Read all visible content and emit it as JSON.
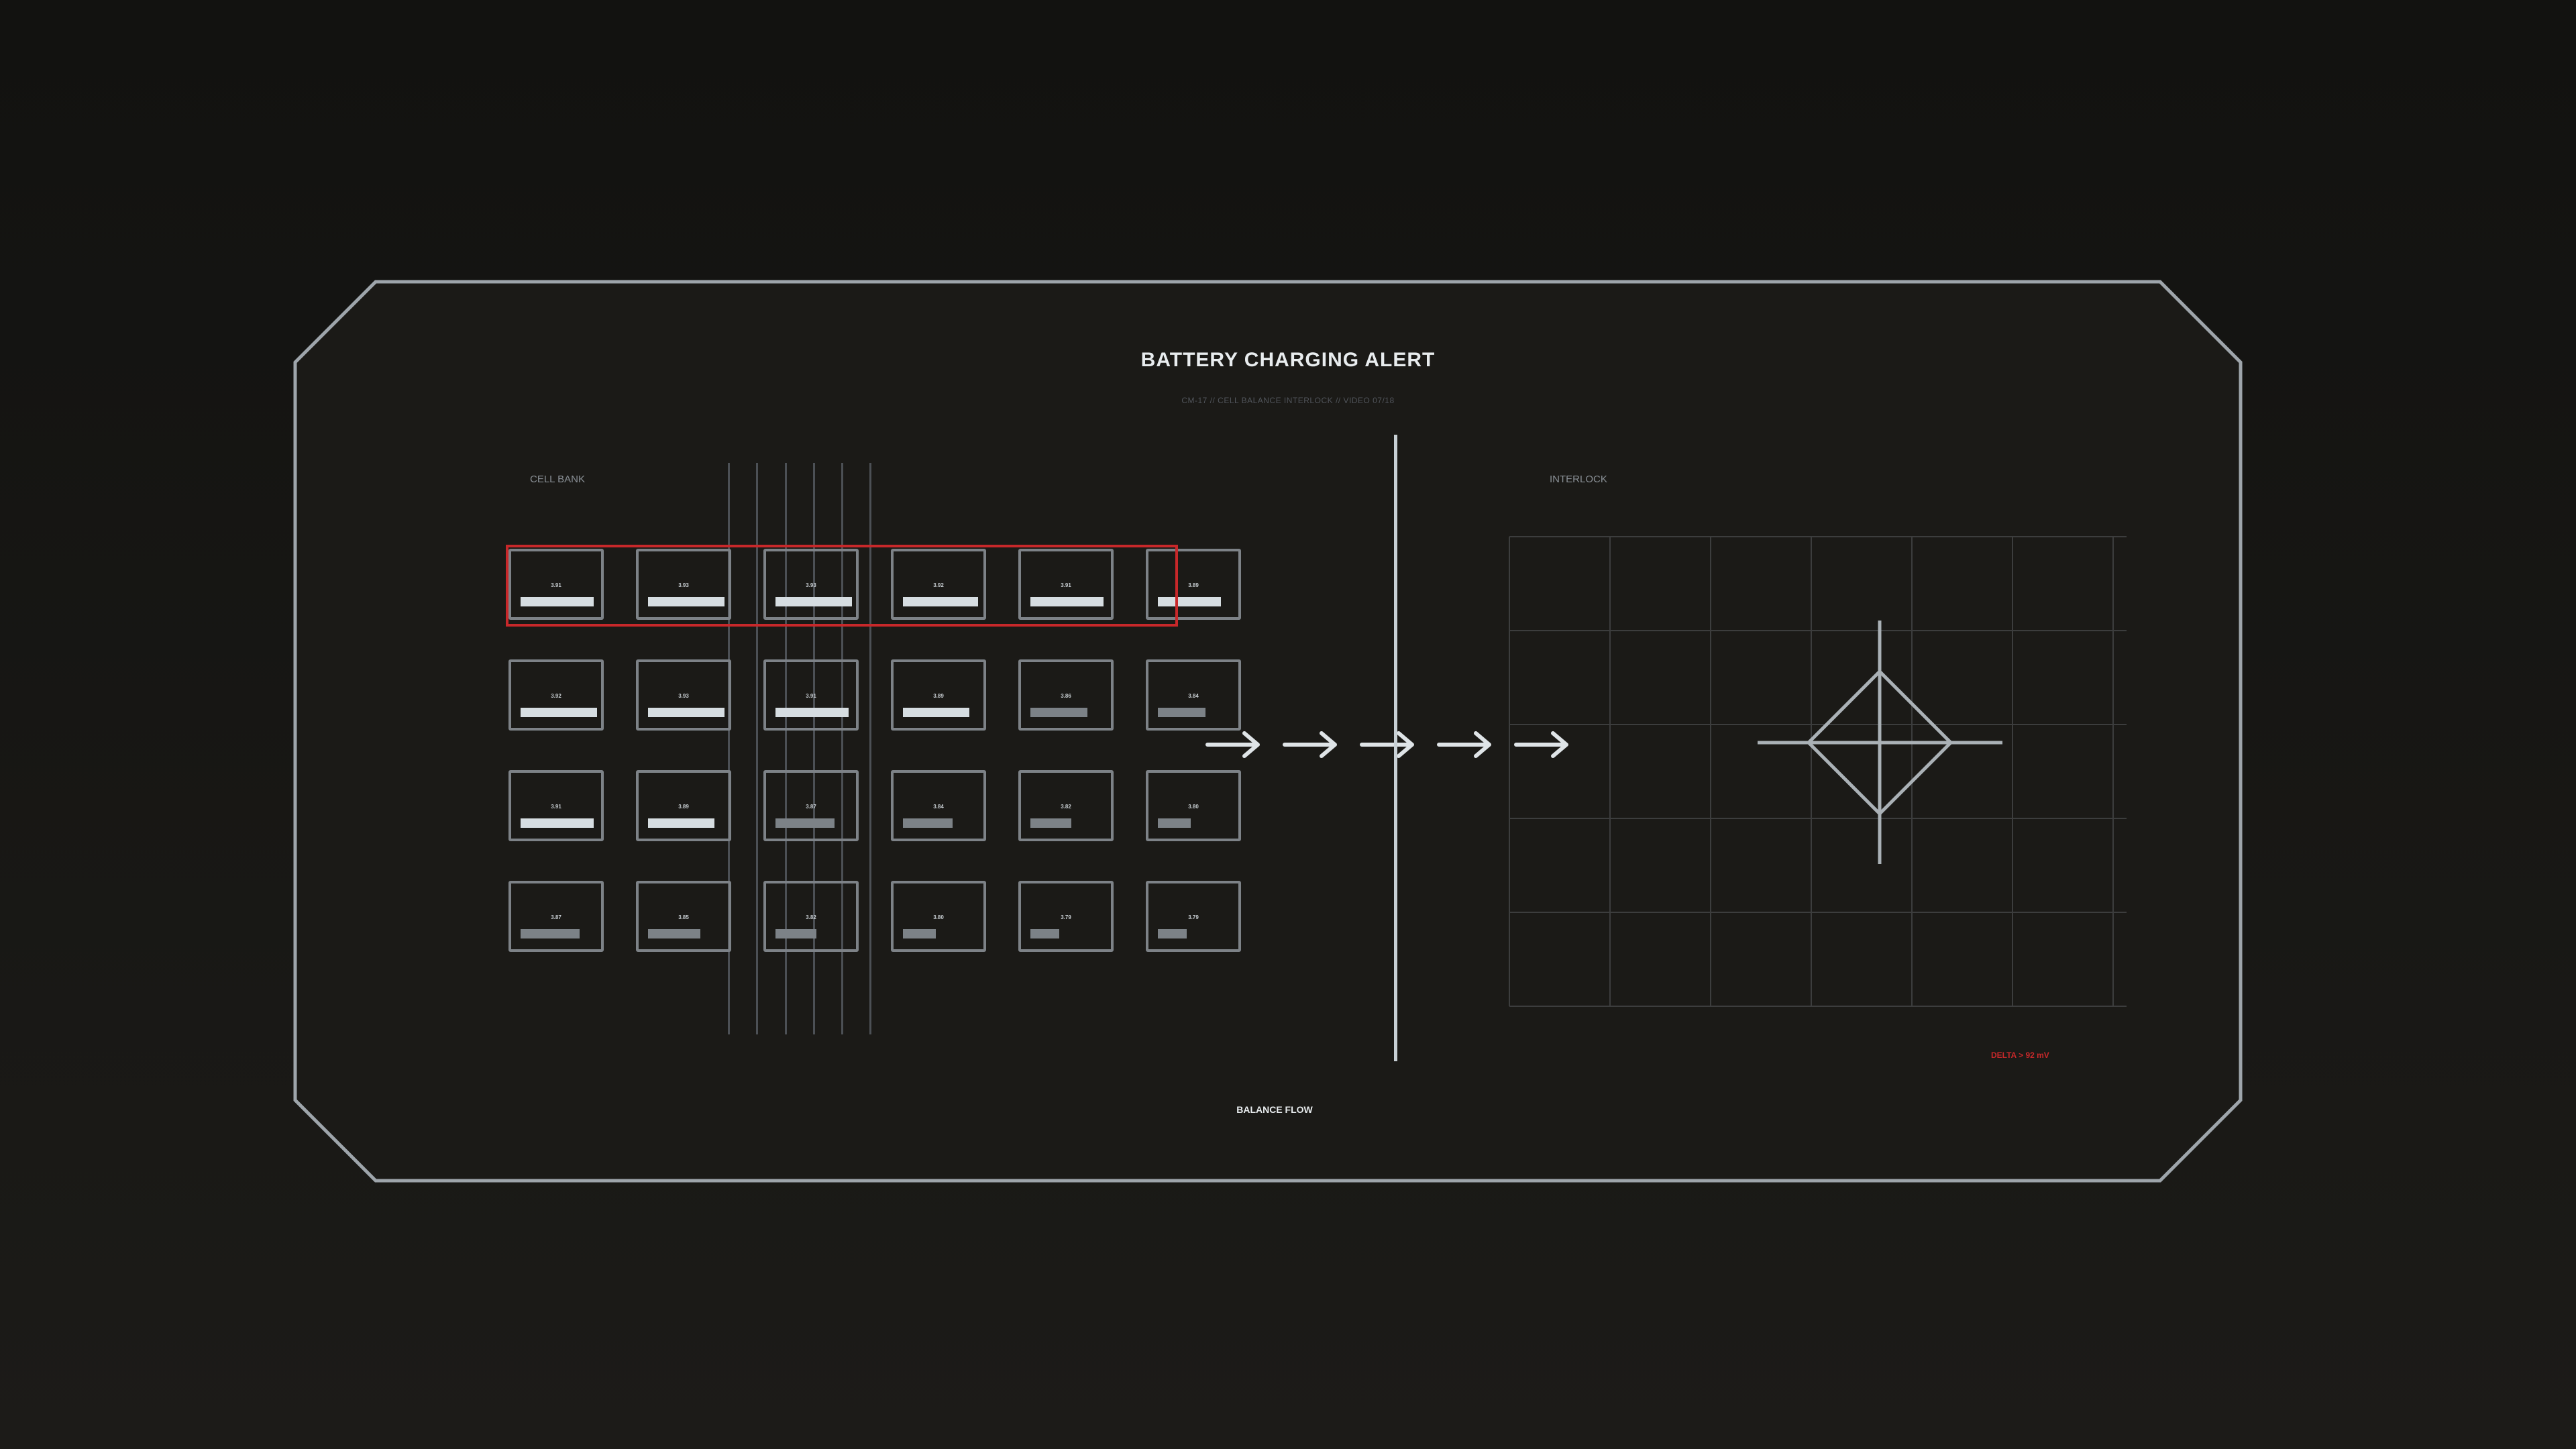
{
  "header": {
    "title": "BATTERY CHARGING ALERT",
    "subtitle": "CM-17  //  CELL BALANCE INTERLOCK  //  VIDEO 07/18"
  },
  "cell_bank": {
    "label": "CELL BANK",
    "cells": [
      {
        "voltage": "3.91",
        "level": 0.72
      },
      {
        "voltage": "3.93",
        "level": 0.75
      },
      {
        "voltage": "3.93",
        "level": 0.75
      },
      {
        "voltage": "3.92",
        "level": 0.74
      },
      {
        "voltage": "3.91",
        "level": 0.72
      },
      {
        "voltage": "3.89",
        "level": 0.62
      },
      {
        "voltage": "3.92",
        "level": 0.78
      },
      {
        "voltage": "3.93",
        "level": 0.76
      },
      {
        "voltage": "3.91",
        "level": 0.72
      },
      {
        "voltage": "3.89",
        "level": 0.65
      },
      {
        "voltage": "3.86",
        "level": 0.56
      },
      {
        "voltage": "3.84",
        "level": 0.47
      },
      {
        "voltage": "3.91",
        "level": 0.72
      },
      {
        "voltage": "3.89",
        "level": 0.65
      },
      {
        "voltage": "3.87",
        "level": 0.58
      },
      {
        "voltage": "3.84",
        "level": 0.49
      },
      {
        "voltage": "3.82",
        "level": 0.4
      },
      {
        "voltage": "3.80",
        "level": 0.32
      },
      {
        "voltage": "3.87",
        "level": 0.58
      },
      {
        "voltage": "3.85",
        "level": 0.51
      },
      {
        "voltage": "3.82",
        "level": 0.4
      },
      {
        "voltage": "3.80",
        "level": 0.32
      },
      {
        "voltage": "3.79",
        "level": 0.28
      },
      {
        "voltage": "3.79",
        "level": 0.28
      }
    ],
    "columns": 6,
    "alert_row": 0
  },
  "interlock": {
    "label": "INTERLOCK",
    "grid_columns": 6,
    "grid_rows": 5
  },
  "balance_flow": {
    "label": "BALANCE FLOW",
    "arrow_count": 5
  },
  "alert": {
    "delta_text": "DELTA > 92 mV"
  },
  "colors": {
    "background": "#16150f",
    "frame": "#9ea5ab",
    "alert_red": "#c8282a",
    "cell_border": "#7d8287",
    "bar_high": "#d6dde1",
    "bar_low": "#7c8287",
    "divider": "#c8d0d5"
  }
}
